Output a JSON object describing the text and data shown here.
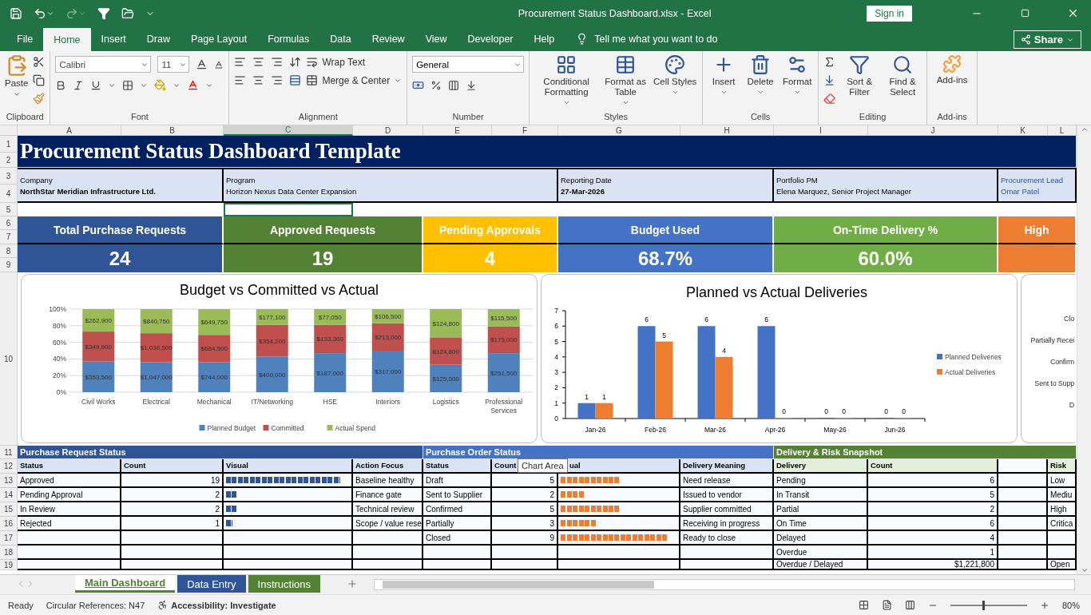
{
  "window": {
    "title": "Procurement Status Dashboard.xlsx  -  Excel",
    "sign_in": "Sign in"
  },
  "menu_tabs": [
    {
      "label": "File",
      "selected": false
    },
    {
      "label": "Home",
      "selected": true
    },
    {
      "label": "Insert",
      "selected": false
    },
    {
      "label": "Draw",
      "selected": false
    },
    {
      "label": "Page Layout",
      "selected": false
    },
    {
      "label": "Formulas",
      "selected": false
    },
    {
      "label": "Data",
      "selected": false
    },
    {
      "label": "Review",
      "selected": false
    },
    {
      "label": "View",
      "selected": false
    },
    {
      "label": "Developer",
      "selected": false
    },
    {
      "label": "Help",
      "selected": false
    }
  ],
  "tell_me": "Tell me what you want to do",
  "share": "Share",
  "ribbon": [
    {
      "kind": "clipboard",
      "label": "Clipboard",
      "items": [
        "Paste"
      ]
    },
    {
      "kind": "font",
      "label": "Font",
      "items": [
        "Calibri",
        "11"
      ]
    },
    {
      "kind": "alignment",
      "label": "Alignment",
      "items": [
        "Wrap Text",
        "Merge & Center"
      ]
    },
    {
      "kind": "number",
      "label": "Number",
      "items": [
        "General"
      ]
    },
    {
      "kind": "styles",
      "label": "Styles",
      "items": [
        "Conditional Formatting",
        "Format as Table",
        "Cell Styles"
      ]
    },
    {
      "kind": "cells",
      "label": "Cells",
      "items": [
        "Insert",
        "Delete",
        "Format"
      ]
    },
    {
      "kind": "editing",
      "label": "Editing",
      "items": [
        "Sort & Filter",
        "Find & Select"
      ]
    },
    {
      "kind": "addins",
      "label": "Add-ins",
      "items": [
        "Add-ins"
      ]
    }
  ],
  "column_headers": [
    {
      "label": "A",
      "selected": false
    },
    {
      "label": "B",
      "selected": false
    },
    {
      "label": "C",
      "selected": true
    },
    {
      "label": "D",
      "selected": false
    },
    {
      "label": "E",
      "selected": false
    },
    {
      "label": "F",
      "selected": false
    },
    {
      "label": "G",
      "selected": false
    },
    {
      "label": "H",
      "selected": false
    },
    {
      "label": "I",
      "selected": false
    },
    {
      "label": "J",
      "selected": false
    },
    {
      "label": "K",
      "selected": false
    },
    {
      "label": "L",
      "selected": false
    }
  ],
  "row_headers": [
    "1",
    "2",
    "3",
    "4",
    "5",
    "6",
    "7",
    "8",
    "9",
    "10",
    "11",
    "12",
    "13",
    "14",
    "15",
    "16",
    "17",
    "18",
    "19"
  ],
  "sheet_title": "Procurement Status Dashboard Template",
  "info": [
    {
      "label": "Company",
      "value": "NorthStar Meridian Infrastructure Ltd."
    },
    {
      "label": "Program",
      "value": "Horizon Nexus Data Center Expansion"
    },
    {
      "label": "Reporting Date",
      "value": "27-Mar-2026"
    },
    {
      "label": "Portfolio PM",
      "value": "Elena Marquez, Senior Project Manager"
    },
    {
      "label": "Procurement Lead",
      "value": "Omar Patel"
    }
  ],
  "kpis": [
    {
      "label": "Total Purchase Requests",
      "value": "24",
      "color": "#2f5597"
    },
    {
      "label": "Approved Requests",
      "value": "19",
      "color": "#548235"
    },
    {
      "label": "Pending Approvals",
      "value": "4",
      "color": "#ffc000"
    },
    {
      "label": "Budget Used",
      "value": "68.7%",
      "color": "#4472c4"
    },
    {
      "label": "On-Time Delivery %",
      "value": "60.0%",
      "color": "#70ad47"
    },
    {
      "label": "High",
      "color": "#ed7d31"
    }
  ],
  "charts": [
    {
      "chart_data": {
        "type": "bar",
        "stacked": true,
        "title": "Budget vs Committed vs Actual",
        "categories": [
          "Civil Works",
          "Electrical",
          "Mechanical",
          "IT/Networking",
          "HSE",
          "Interiors",
          "Logistics",
          "Professional Services"
        ],
        "series": [
          {
            "name": "Planned Budget",
            "color": "#4f81bd",
            "values": [
              0.37,
              0.36,
              0.36,
              0.43,
              0.47,
              0.5,
              0.33,
              0.47
            ]
          },
          {
            "name": "Committed",
            "color": "#c0504d",
            "values": [
              0.36,
              0.35,
              0.33,
              0.38,
              0.34,
              0.33,
              0.33,
              0.32
            ]
          },
          {
            "name": "Actual Spend",
            "color": "#9bbb59",
            "values": [
              0.27,
              0.29,
              0.31,
              0.19,
              0.19,
              0.17,
              0.34,
              0.21
            ]
          }
        ],
        "annotations": [
          "$353,500",
          "$349,900",
          "$262,900",
          "$1,047,000",
          "$1,038,500",
          "$840,750",
          "$744,000",
          "$684,500",
          "$649,750",
          "$400,000",
          "$354,200",
          "$177,100",
          "$187,000",
          "$133,300",
          "$77,050",
          "$317,000",
          "$213,000",
          "$106,500",
          "$125,000",
          "$124,800",
          "$124,800",
          "$251,500",
          "$175,000",
          "$115,500"
        ],
        "ylim": [
          0,
          1
        ],
        "yticks": [
          {
            "value": 0,
            "label": "0%"
          },
          {
            "value": 0.2,
            "label": "20%"
          },
          {
            "value": 0.4,
            "label": "40%"
          },
          {
            "value": 0.6,
            "label": "60%"
          },
          {
            "value": 0.8,
            "label": "80%"
          },
          {
            "value": 1,
            "label": "100%"
          }
        ],
        "grid": true,
        "legend": "bottom"
      }
    },
    {
      "chart_data": {
        "type": "bar",
        "title": "Planned vs Actual Deliveries",
        "categories": [
          "Jan-26",
          "Feb-26",
          "Mar-26",
          "Apr-26",
          "May-26",
          "Jun-26"
        ],
        "series": [
          {
            "name": "Planned Deliveries",
            "color": "#4472c4",
            "values": [
              1,
              6,
              6,
              6,
              0,
              0
            ],
            "value_labels": [
              "1",
              "6",
              "6",
              "6",
              "0",
              "0"
            ]
          },
          {
            "name": "Actual Deliveries",
            "color": "#ed7d31",
            "values": [
              1,
              5,
              4,
              0,
              0,
              0
            ],
            "value_labels": [
              "1",
              "5",
              "4",
              "0",
              "0",
              "0"
            ]
          }
        ],
        "ylim": [
          0,
          7
        ],
        "yticks": [
          {
            "value": 0,
            "label": "0"
          },
          {
            "value": 1,
            "label": "1"
          },
          {
            "value": 2,
            "label": "2"
          },
          {
            "value": 3,
            "label": "3"
          },
          {
            "value": 4,
            "label": "4"
          },
          {
            "value": 5,
            "label": "5"
          },
          {
            "value": 6,
            "label": "6"
          },
          {
            "value": 7,
            "label": "7"
          }
        ],
        "legend": "right"
      }
    }
  ],
  "chart_3_labels": [
    "Clo",
    "Partially Recei",
    "Confirm",
    "Sent to Supp",
    "D"
  ],
  "tooltip": "Chart Area",
  "sections": [
    {
      "kind": "bars",
      "title": "Purchase Request Status",
      "color": "#2f5597",
      "columns": [
        "Status",
        "Count",
        "Visual",
        "Action Focus"
      ],
      "rows": [
        {
          "status": "Approved",
          "count": "19",
          "level": 0.95,
          "note": "Baseline healthy"
        },
        {
          "status": "Pending Approval",
          "count": "2",
          "level": 0.1,
          "note": "Finance gate"
        },
        {
          "status": "In Review",
          "count": "2",
          "level": 0.1,
          "note": "Technical review"
        },
        {
          "status": "Rejected",
          "count": "1",
          "level": 0.05,
          "note": "Scope / value rese"
        }
      ]
    },
    {
      "kind": "bars",
      "title": "Purchase Order Status",
      "color": "#4472c4",
      "columns": [
        "Status",
        "Count",
        "ual",
        "Delivery Meaning"
      ],
      "rows": [
        {
          "status": "Draft",
          "count": "5",
          "level": 0.5,
          "note": "Need release"
        },
        {
          "status": "Sent to Supplier",
          "count": "2",
          "level": 0.2,
          "note": "Issued to vendor"
        },
        {
          "status": "Confirmed",
          "count": "5",
          "level": 0.5,
          "note": "Supplier committed"
        },
        {
          "status": "Partially",
          "count": "3",
          "level": 0.3,
          "note": "Receiving in progress"
        },
        {
          "status": "Closed",
          "count": "9",
          "level": 0.9,
          "note": "Ready to close"
        }
      ]
    },
    {
      "kind": "plain",
      "title": "Delivery & Risk Snapshot",
      "color": "#548235",
      "columns": [
        "Delivery",
        "Count",
        "Risk"
      ],
      "rows": [
        {
          "status": "Pending",
          "count": "6",
          "risk": "Low"
        },
        {
          "status": "In Transit",
          "count": "5",
          "risk": "Mediu"
        },
        {
          "status": "Partial",
          "count": "2",
          "risk": "High"
        },
        {
          "status": "On Time",
          "count": "6",
          "risk": "Critica"
        },
        {
          "status": "Delayed",
          "count": "4"
        },
        {
          "status": "Overdue",
          "count": "1"
        },
        {
          "status": "Overdue / Delayed",
          "count": "$1,221,800",
          "risk": "Open"
        }
      ]
    }
  ],
  "sheet_tabs": [
    {
      "label": "Main Dashboard",
      "selected": true,
      "color": "#548235"
    },
    {
      "label": "Data Entry",
      "selected": false,
      "color": "#2f5597"
    },
    {
      "label": "Instructions",
      "selected": false,
      "color": "#548235"
    }
  ],
  "status_bar": {
    "ready": "Ready",
    "circular": "Circular References: N47",
    "accessibility": "Accessibility: Investigate",
    "zoom": {
      "level": 0.42,
      "reading": "80%"
    }
  }
}
